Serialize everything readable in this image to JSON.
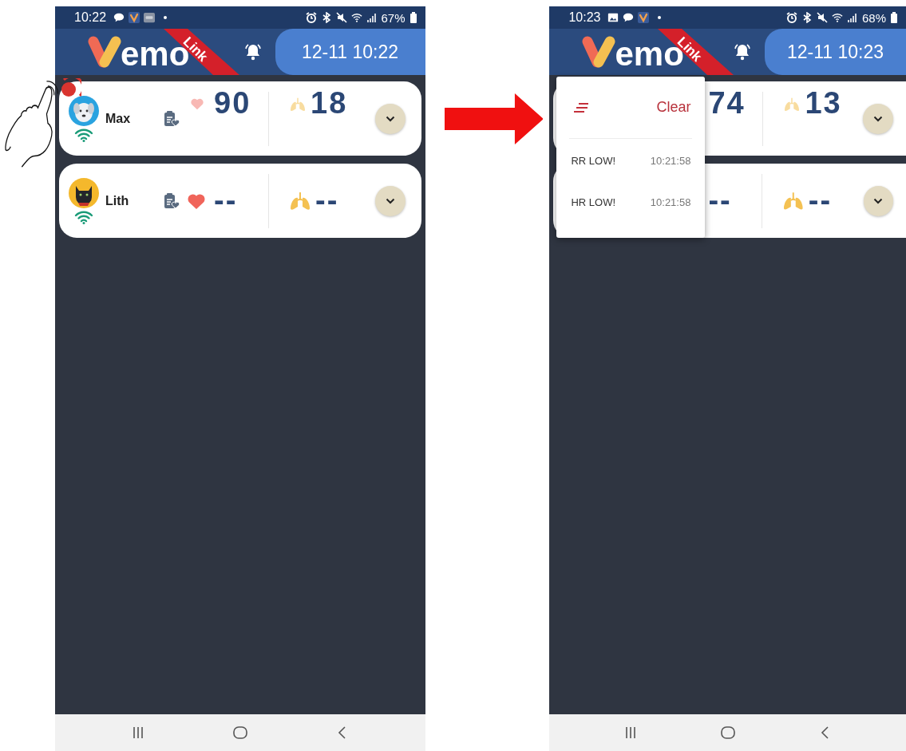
{
  "screens": [
    {
      "status_bar": {
        "time": "10:22",
        "battery": "67%"
      },
      "header": {
        "logo": "emo",
        "ribbon": "Link",
        "datetime": "12-11 10:22"
      },
      "pets": [
        {
          "name": "Max",
          "alert": true,
          "hr": "90",
          "rr": "18",
          "faded": true
        },
        {
          "name": "Lith",
          "alert": false,
          "hr": "--",
          "rr": "--",
          "faded": false
        }
      ]
    },
    {
      "status_bar": {
        "time": "10:23",
        "battery": "68%"
      },
      "header": {
        "logo": "emo",
        "ribbon": "Link",
        "datetime": "12-11 10:23"
      },
      "pets": [
        {
          "hr": "74",
          "rr": "13",
          "faded": true
        },
        {
          "rr": "--",
          "faded": false,
          "hr": "--"
        }
      ],
      "popup": {
        "clear": "Clear",
        "alerts": [
          {
            "text": "RR LOW!",
            "time": "10:21:58"
          },
          {
            "text": "HR LOW!",
            "time": "10:21:58"
          }
        ]
      }
    }
  ]
}
